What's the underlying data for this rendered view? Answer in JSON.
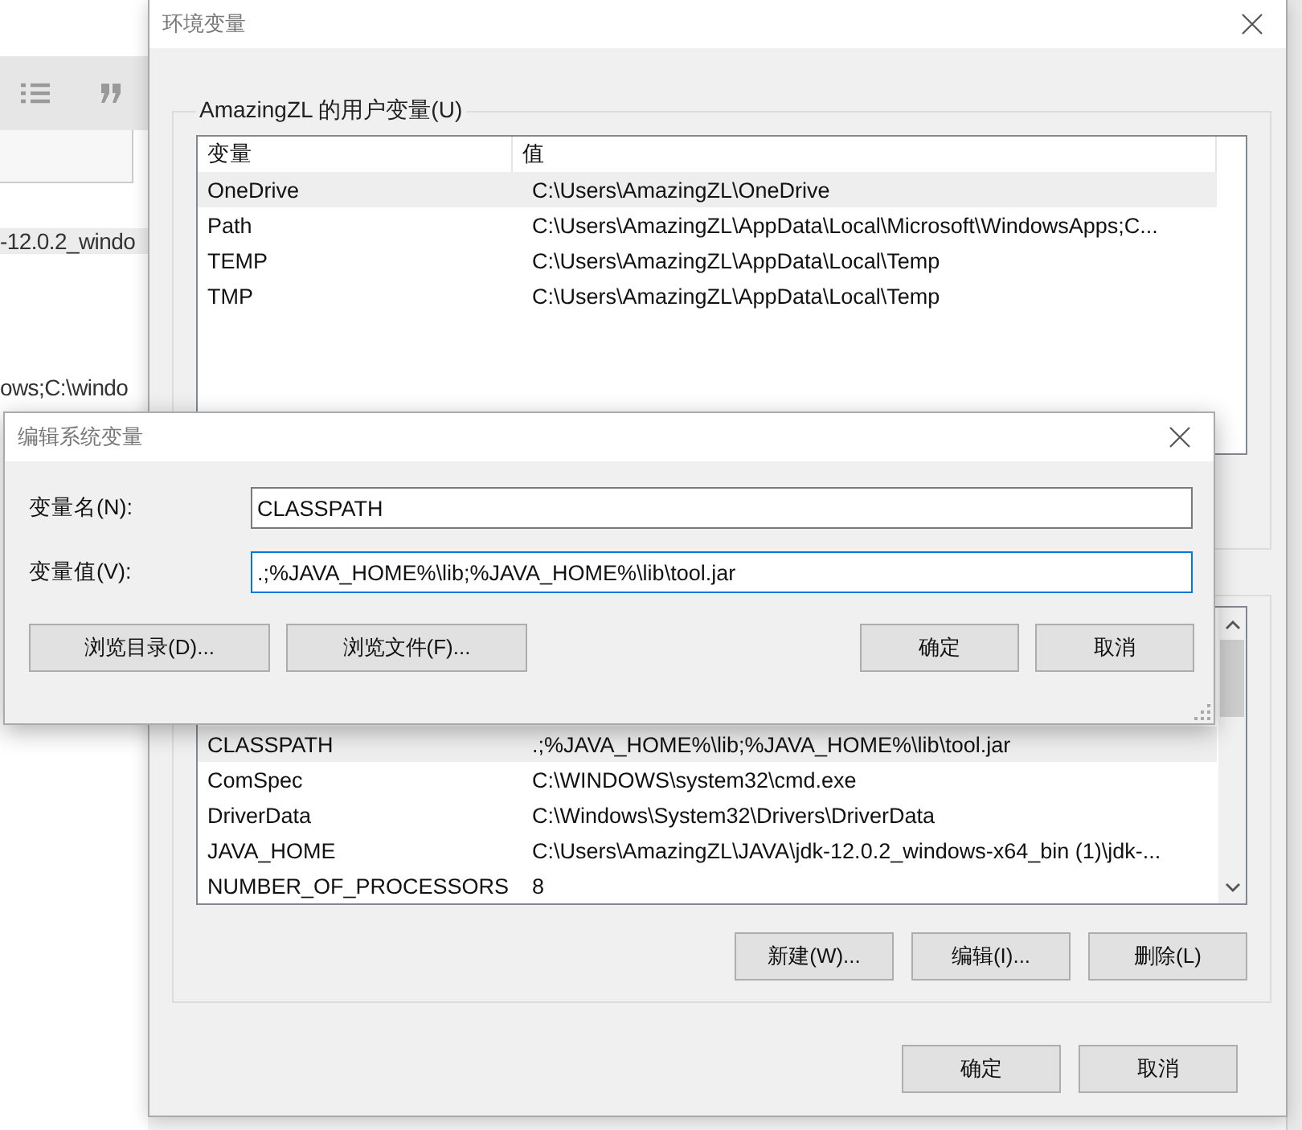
{
  "background_editor": {
    "lines": [
      "-12.0.2_windo",
      "ows;C:\\windo"
    ]
  },
  "window": {
    "title": "环境变量",
    "user_vars": {
      "label": "AmazingZL 的用户变量(U)",
      "columns": [
        "变量",
        "值"
      ],
      "rows": [
        {
          "name": "OneDrive",
          "value": "C:\\Users\\AmazingZL\\OneDrive",
          "selected": true
        },
        {
          "name": "Path",
          "value": "C:\\Users\\AmazingZL\\AppData\\Local\\Microsoft\\WindowsApps;C...",
          "selected": false
        },
        {
          "name": "TEMP",
          "value": "C:\\Users\\AmazingZL\\AppData\\Local\\Temp",
          "selected": false
        },
        {
          "name": "TMP",
          "value": "C:\\Users\\AmazingZL\\AppData\\Local\\Temp",
          "selected": false
        }
      ]
    },
    "system_vars": {
      "rows": [
        {
          "name": "CLASSPATH",
          "value": ".;%JAVA_HOME%\\lib;%JAVA_HOME%\\lib\\tool.jar",
          "selected": true
        },
        {
          "name": "ComSpec",
          "value": "C:\\WINDOWS\\system32\\cmd.exe",
          "selected": false
        },
        {
          "name": "DriverData",
          "value": "C:\\Windows\\System32\\Drivers\\DriverData",
          "selected": false
        },
        {
          "name": "JAVA_HOME",
          "value": "C:\\Users\\AmazingZL\\JAVA\\jdk-12.0.2_windows-x64_bin (1)\\jdk-...",
          "selected": false
        },
        {
          "name": "NUMBER_OF_PROCESSORS",
          "value": "8",
          "selected": false
        }
      ],
      "buttons": [
        "新建(W)...",
        "编辑(I)...",
        "删除(L)"
      ]
    },
    "buttons": [
      "确定",
      "取消"
    ]
  },
  "dialog": {
    "title": "编辑系统变量",
    "fields": [
      {
        "label": "变量名(N):",
        "value": "CLASSPATH",
        "focused": false
      },
      {
        "label": "变量值(V):",
        "value": ".;%JAVA_HOME%\\lib;%JAVA_HOME%\\lib\\tool.jar",
        "focused": true
      }
    ],
    "browse_buttons": [
      "浏览目录(D)...",
      "浏览文件(F)..."
    ],
    "buttons": [
      "确定",
      "取消"
    ]
  }
}
